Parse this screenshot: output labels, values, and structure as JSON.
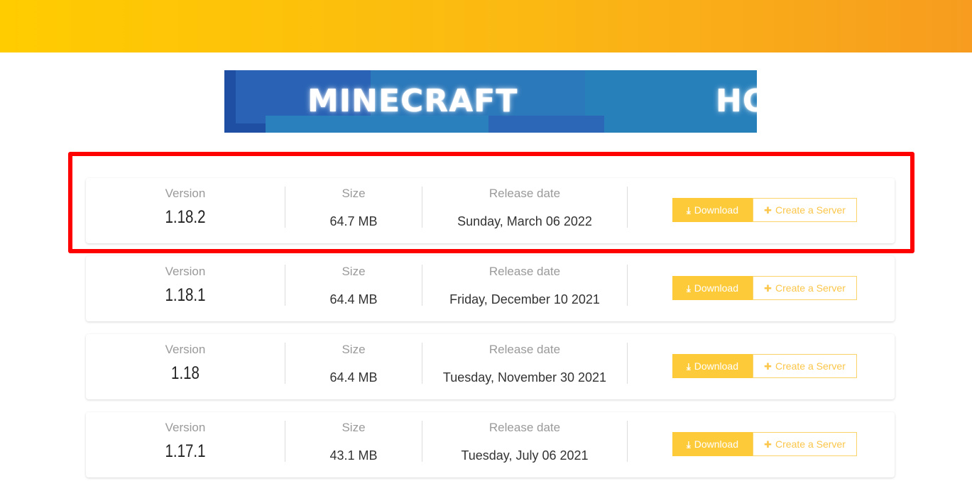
{
  "banner": {
    "text_left": "MINECRAFT",
    "text_right": "HO"
  },
  "labels": {
    "version": "Version",
    "size": "Size",
    "release_date": "Release date",
    "download": "Download",
    "create_server": "Create a Server"
  },
  "icons": {
    "download": "download-icon",
    "create_server": "plus-icon"
  },
  "colors": {
    "accent": "#fdca3a",
    "highlight": "#ff0000",
    "topbar_start": "#ffcc00",
    "topbar_end": "#f79c1f"
  },
  "releases": [
    {
      "version": "1.18.2",
      "size": "64.7 MB",
      "release_date": "Sunday, March 06 2022",
      "highlighted": true
    },
    {
      "version": "1.18.1",
      "size": "64.4 MB",
      "release_date": "Friday, December 10 2021",
      "highlighted": false
    },
    {
      "version": "1.18",
      "size": "64.4 MB",
      "release_date": "Tuesday, November 30 2021",
      "highlighted": false
    },
    {
      "version": "1.17.1",
      "size": "43.1 MB",
      "release_date": "Tuesday, July 06 2021",
      "highlighted": false
    }
  ]
}
